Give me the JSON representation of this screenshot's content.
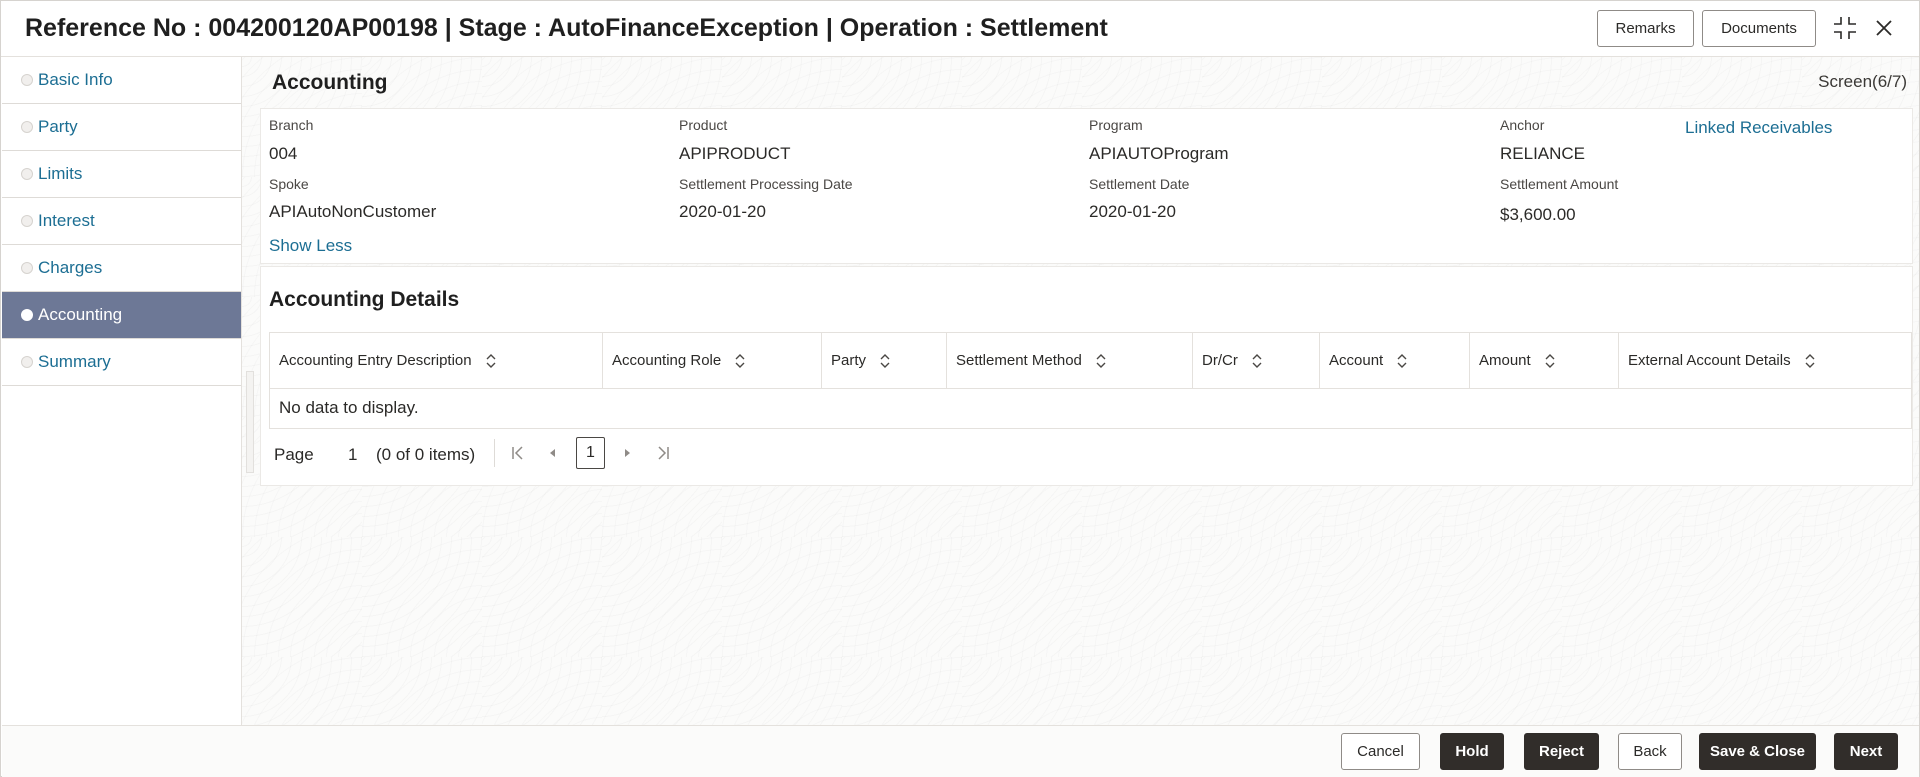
{
  "header": {
    "title": "Reference No : 004200120AP00198 | Stage : AutoFinanceException | Operation : Settlement",
    "remarks_label": "Remarks",
    "documents_label": "Documents",
    "minimize_icon": "collapse-icon",
    "close_icon": "close-icon"
  },
  "sidebar": {
    "items": [
      {
        "label": "Basic Info",
        "active": false
      },
      {
        "label": "Party",
        "active": false
      },
      {
        "label": "Limits",
        "active": false
      },
      {
        "label": "Interest",
        "active": false
      },
      {
        "label": "Charges",
        "active": false
      },
      {
        "label": "Accounting",
        "active": true
      },
      {
        "label": "Summary",
        "active": false
      }
    ]
  },
  "main": {
    "section_title": "Accounting",
    "screen_indicator": "Screen(6/7)",
    "fields": {
      "branch": {
        "label": "Branch",
        "value": "004"
      },
      "product": {
        "label": "Product",
        "value": "APIPRODUCT"
      },
      "program": {
        "label": "Program",
        "value": "APIAUTOProgram"
      },
      "anchor": {
        "label": "Anchor",
        "value": "RELIANCE"
      },
      "spoke": {
        "label": "Spoke",
        "value": "APIAutoNonCustomer"
      },
      "settlement_processing_date": {
        "label": "Settlement Processing Date",
        "value": "2020-01-20"
      },
      "settlement_date": {
        "label": "Settlement Date",
        "value": "2020-01-20"
      },
      "settlement_amount": {
        "label": "Settlement Amount",
        "value": "$3,600.00"
      }
    },
    "linked_receivables_label": "Linked Receivables",
    "show_less_label": "Show Less"
  },
  "accounting_details": {
    "title": "Accounting Details",
    "columns": [
      "Accounting Entry Description",
      "Accounting Role",
      "Party",
      "Settlement Method",
      "Dr/Cr",
      "Account",
      "Amount",
      "External Account Details"
    ],
    "empty_text": "No data to display."
  },
  "pagination": {
    "page_label": "Page",
    "page_number": "1",
    "items_summary": "(0 of 0 items)",
    "current_page": "1"
  },
  "footer": {
    "cancel_label": "Cancel",
    "hold_label": "Hold",
    "reject_label": "Reject",
    "back_label": "Back",
    "save_close_label": "Save & Close",
    "next_label": "Next"
  },
  "colors": {
    "accent_link": "#1c6e93",
    "active_nav_bg": "#6d7896",
    "dark_button": "#312d2a"
  }
}
